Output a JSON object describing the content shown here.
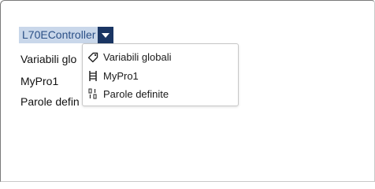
{
  "controller_selector": {
    "label": "L70EController",
    "arrow_icon": "caret-down-icon"
  },
  "background_list": [
    {
      "label": "Variabili glo"
    },
    {
      "label": "MyPro1"
    },
    {
      "label": "Parole defin"
    }
  ],
  "dropdown": {
    "items": [
      {
        "label": "Variabili globali",
        "icon": "tag-icon"
      },
      {
        "label": "MyPro1",
        "icon": "ladder-icon"
      },
      {
        "label": "Parole definite",
        "icon": "binary-icon"
      }
    ]
  },
  "colors": {
    "selector_bg": "#c9d7ea",
    "selector_text": "#2a4f86",
    "arrow_bg": "#1a3563"
  }
}
